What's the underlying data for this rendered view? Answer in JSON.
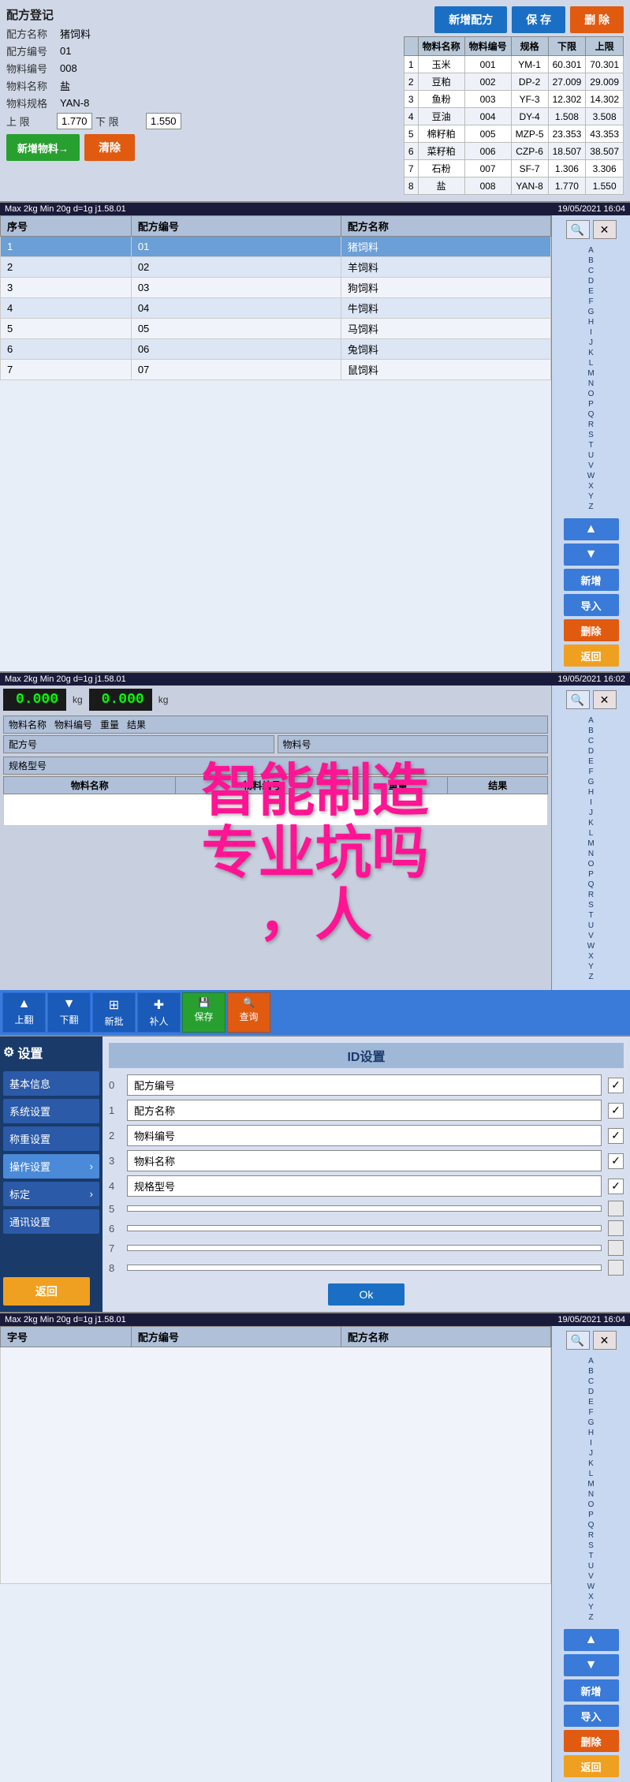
{
  "section1": {
    "title": "配方登记",
    "formula_name_label": "配方名称",
    "formula_name_value": "猪饲料",
    "formula_code_label": "配方编号",
    "formula_code_value": "01",
    "material_code_label": "物料编号",
    "material_code_value": "008",
    "material_name_label": "物料名称",
    "material_name_value": "盐",
    "material_spec_label": "物料规格",
    "material_spec_value": "YAN-8",
    "upper_limit_label": "上  限",
    "upper_limit_value": "1.770",
    "lower_limit_label": "下  限",
    "lower_limit_value": "1.550",
    "btn_add": "新增配方",
    "btn_save": "保    存",
    "btn_delete": "删   除",
    "btn_add_material": "新增物料→",
    "btn_clear": "清除",
    "table_headers": [
      "物料名称",
      "物料编号",
      "规格",
      "下限",
      "上限"
    ],
    "table_rows": [
      {
        "no": "1",
        "name": "玉米",
        "code": "001",
        "spec": "YM-1",
        "lower": "60.301",
        "upper": "70.301"
      },
      {
        "no": "2",
        "name": "豆粕",
        "code": "002",
        "spec": "DP-2",
        "lower": "27.009",
        "upper": "29.009"
      },
      {
        "no": "3",
        "name": "鱼粉",
        "code": "003",
        "spec": "YF-3",
        "lower": "12.302",
        "upper": "14.302"
      },
      {
        "no": "4",
        "name": "豆油",
        "code": "004",
        "spec": "DY-4",
        "lower": "1.508",
        "upper": "3.508"
      },
      {
        "no": "5",
        "name": "棉籽粕",
        "code": "005",
        "spec": "MZP-5",
        "lower": "23.353",
        "upper": "43.353"
      },
      {
        "no": "6",
        "name": "菜籽粕",
        "code": "006",
        "spec": "CZP-6",
        "lower": "18.507",
        "upper": "38.507"
      },
      {
        "no": "7",
        "name": "石粉",
        "code": "007",
        "spec": "SF-7",
        "lower": "1.306",
        "upper": "3.306"
      },
      {
        "no": "8",
        "name": "盐",
        "code": "008",
        "spec": "YAN-8",
        "lower": "1.770",
        "upper": "1.550"
      }
    ]
  },
  "section2": {
    "header_left": "Max 2kg  Min 20g  d=1g   j1.58.01",
    "header_right": "19/05/2021  16:04",
    "col_no": "序号",
    "col_code": "配方编号",
    "col_name": "配方名称",
    "rows": [
      {
        "no": "1",
        "code": "01",
        "name": "猪饲料",
        "selected": true
      },
      {
        "no": "2",
        "code": "02",
        "name": "羊饲料"
      },
      {
        "no": "3",
        "code": "03",
        "name": "狗饲料"
      },
      {
        "no": "4",
        "code": "04",
        "name": "牛饲料"
      },
      {
        "no": "5",
        "code": "05",
        "name": "马饲料"
      },
      {
        "no": "6",
        "code": "06",
        "name": "兔饲料"
      },
      {
        "no": "7",
        "code": "07",
        "name": "鼠饲料"
      }
    ],
    "alpha": [
      "A",
      "B",
      "C",
      "D",
      "E",
      "F",
      "G",
      "H",
      "I",
      "J",
      "K",
      "L",
      "M",
      "N",
      "O",
      "P",
      "Q",
      "R",
      "S",
      "T",
      "U",
      "V",
      "W",
      "X",
      "Y",
      "Z"
    ],
    "btn_add": "新增",
    "btn_import": "导入",
    "btn_delete": "删除",
    "btn_back": "返回"
  },
  "watermark": {
    "line1": "智能制造",
    "line2": "专业坑吗",
    "line3": "，人"
  },
  "section3": {
    "header_left": "Max 2kg  Min 20g  d=1g   j1.58.01",
    "header_right": "19/05/2021  16:02",
    "display1": "0.000",
    "display2": "0.000",
    "unit1": "kg",
    "unit2": "kg",
    "inner_header": "物料名称    物料编号    重量    结果",
    "inner_header2": "配方号    物料号",
    "inner_header3": "规格型号",
    "table_cols": [
      "物料名称",
      "物料编号",
      "重量",
      "结果"
    ],
    "toolbar_items": [
      {
        "label": "上翻",
        "icon": "▲"
      },
      {
        "label": "下翻",
        "icon": "▼"
      },
      {
        "label": "新批",
        "icon": "⊞"
      },
      {
        "label": "补人",
        "icon": "✚"
      },
      {
        "label": "保存",
        "icon": "💾"
      },
      {
        "label": "查询",
        "icon": "🔍"
      }
    ]
  },
  "section4": {
    "title": "设置",
    "gear_icon": "⚙",
    "menu_items": [
      {
        "label": "基本信息",
        "has_arrow": false
      },
      {
        "label": "系统设置",
        "has_arrow": false
      },
      {
        "label": "称重设置",
        "has_arrow": false
      },
      {
        "label": "操作设置",
        "has_arrow": true
      },
      {
        "label": "标定",
        "has_arrow": true
      },
      {
        "label": "通讯设置",
        "has_arrow": false
      }
    ],
    "btn_back": "返回",
    "id_panel_title": "ID设置",
    "id_rows": [
      {
        "no": "0",
        "label": "配方编号",
        "checked": true
      },
      {
        "no": "1",
        "label": "配方名称",
        "checked": true
      },
      {
        "no": "2",
        "label": "物料编号",
        "checked": true
      },
      {
        "no": "3",
        "label": "物料名称",
        "checked": true
      },
      {
        "no": "4",
        "label": "规格型号",
        "checked": true
      },
      {
        "no": "5",
        "label": "",
        "checked": false
      },
      {
        "no": "6",
        "label": "",
        "checked": false
      },
      {
        "no": "7",
        "label": "",
        "checked": false
      },
      {
        "no": "8",
        "label": "",
        "checked": false
      }
    ],
    "btn_ok": "Ok"
  },
  "section5": {
    "header_left": "Max 2kg  Min 20g  d=1g   j1.58.01",
    "header_right": "19/05/2021  16:04",
    "col_no": "字号",
    "col_code": "配方编号",
    "col_name": "配方名称",
    "rows": [],
    "alpha": [
      "A",
      "B",
      "C",
      "D",
      "E",
      "F",
      "G",
      "H",
      "I",
      "J",
      "K",
      "L",
      "M",
      "N",
      "O",
      "P",
      "Q",
      "R",
      "S",
      "T",
      "U",
      "V",
      "W",
      "X",
      "Y",
      "Z"
    ],
    "btn_add": "新增",
    "btn_import": "导入",
    "btn_delete": "删除",
    "btn_back": "返回"
  }
}
